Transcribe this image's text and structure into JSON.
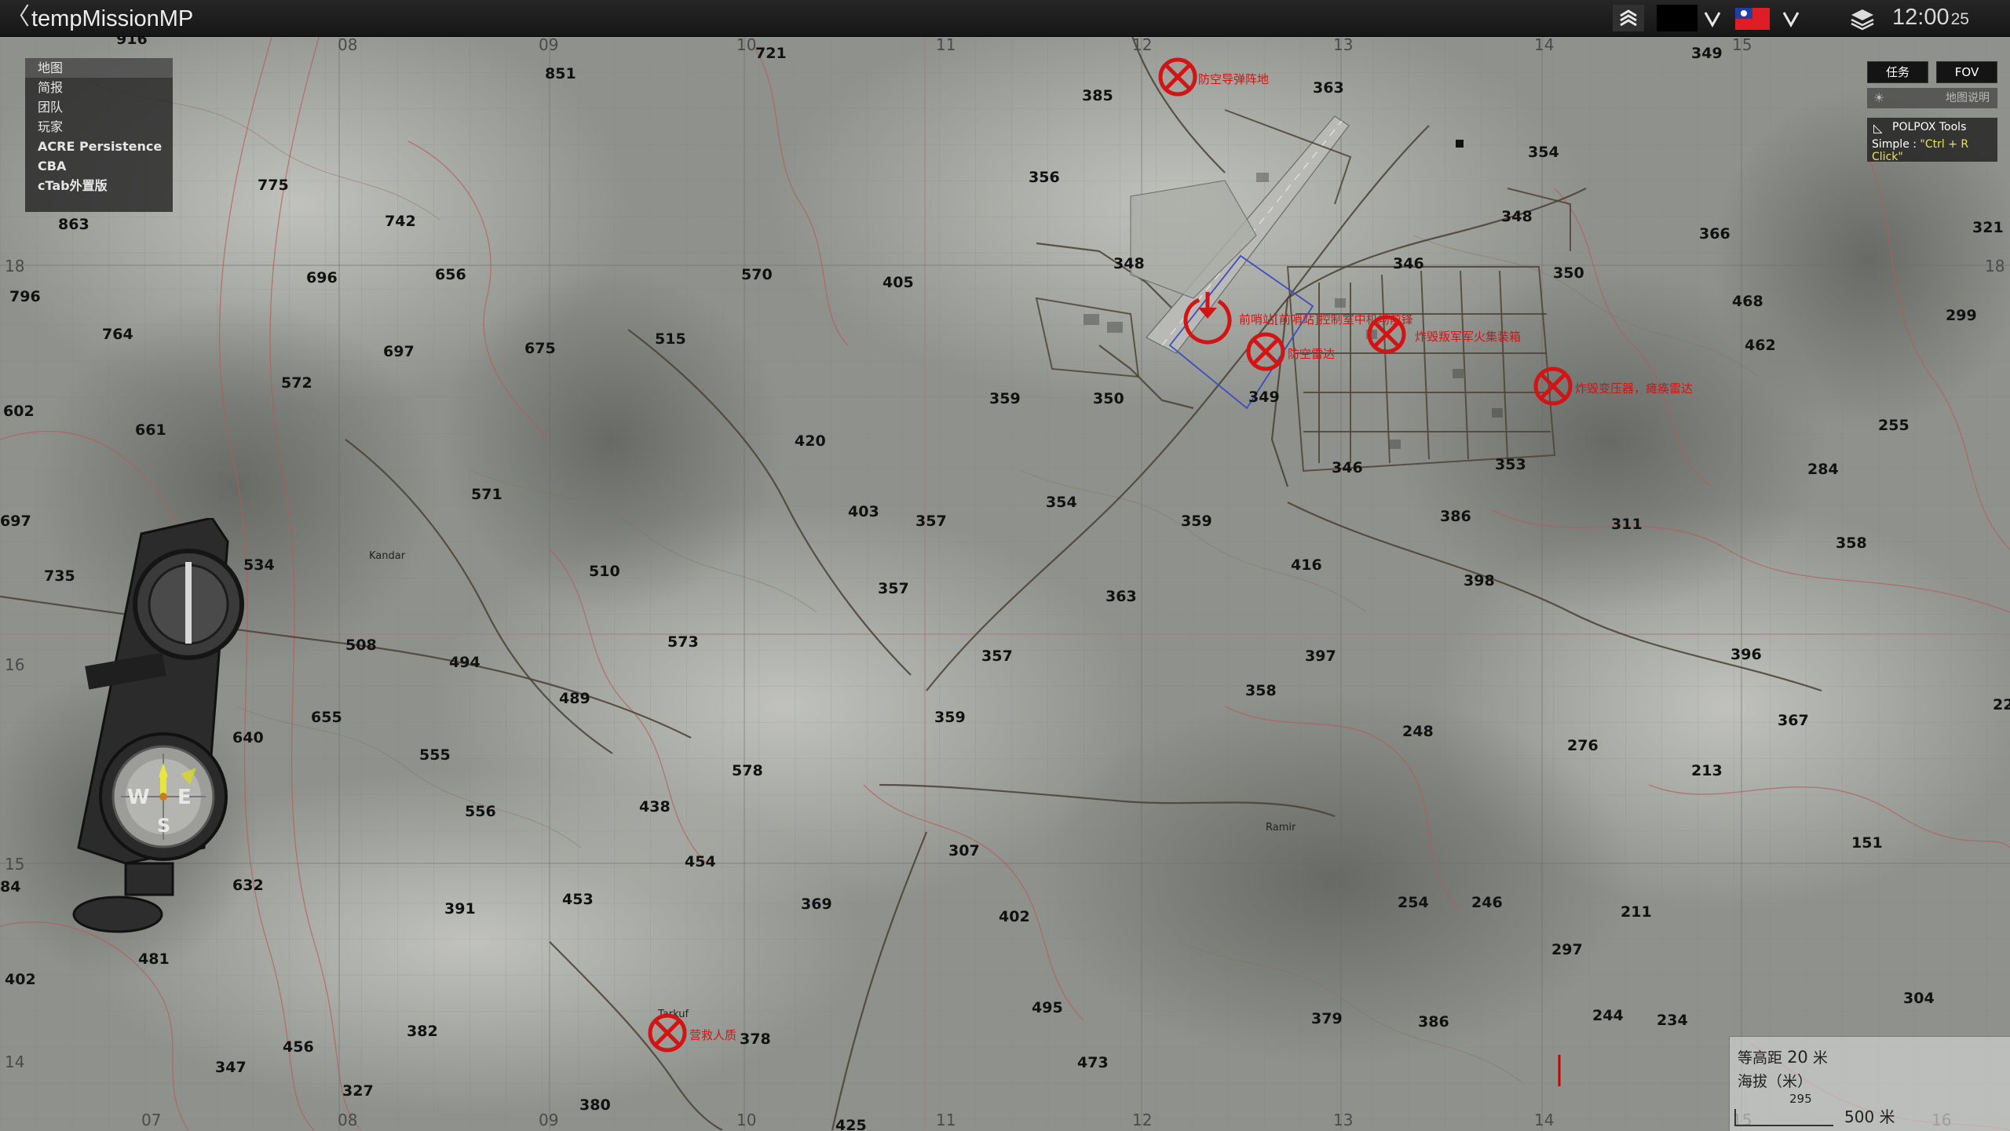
{
  "window": {
    "title": "tempMissionMP",
    "back_label": "〈"
  },
  "topbar": {
    "icons": [
      "map-layers-icon",
      "black-flag-icon",
      "chevron-down-icon",
      "taiwan-flag-icon",
      "chevron-down-icon",
      "layers-icon"
    ],
    "clock_hm": "12:00",
    "clock_s": "25"
  },
  "side_menu": {
    "items": [
      {
        "label": "地图",
        "active": true,
        "bold": false
      },
      {
        "label": "简报",
        "active": false,
        "bold": false
      },
      {
        "label": "团队",
        "active": false,
        "bold": false
      },
      {
        "label": "玩家",
        "active": false,
        "bold": false
      },
      {
        "label": "ACRE Persistence",
        "active": false,
        "bold": true
      },
      {
        "label": "CBA",
        "active": false,
        "bold": true
      },
      {
        "label": "cTab外置版",
        "active": false,
        "bold": true
      }
    ]
  },
  "right_panel": {
    "task_label": "任务",
    "fov_label": "FOV",
    "legend_label": "地图说明",
    "polpox_title": "POLPOX Tools",
    "polpox_hint_prefix": "Simple : ",
    "polpox_hint_key": "\"Ctrl + R Click\""
  },
  "scale": {
    "contour_label": "等高距",
    "contour_value": "20",
    "contour_unit": "米",
    "altitude_label": "海拔（米）",
    "altitude_value": "295",
    "distance_value": "500",
    "distance_unit": "米"
  },
  "grid": {
    "top_labels": [
      "08",
      "09",
      "10",
      "11",
      "12",
      "13",
      "14",
      "15"
    ],
    "bottom_labels": [
      "07",
      "08",
      "09",
      "10",
      "11",
      "12",
      "13",
      "14",
      "15",
      "16"
    ],
    "left_labels": [
      "18",
      "16",
      "15",
      "14"
    ]
  },
  "compass": {
    "w": "W",
    "e": "E",
    "s": "S"
  },
  "towns": [
    "Kandar",
    "Ramir",
    "Tarkuf"
  ],
  "markers": [
    {
      "type": "destroy",
      "label": "防空导弹阵地"
    },
    {
      "type": "start",
      "label": "前哨站[前哨站]控制室中机场前锋"
    },
    {
      "type": "destroy",
      "label": "防空雷达"
    },
    {
      "type": "destroy",
      "label": "炸毁叛军军火集装箱"
    },
    {
      "type": "destroy",
      "label": "炸毁变压器，瘫痪雷达"
    },
    {
      "type": "destroy",
      "label": "营救人质"
    }
  ],
  "elevations": [
    {
      "v": "916"
    },
    {
      "v": "851"
    },
    {
      "v": "721"
    },
    {
      "v": "385"
    },
    {
      "v": "363"
    },
    {
      "v": "349"
    },
    {
      "v": "356"
    },
    {
      "v": "354"
    },
    {
      "v": "348"
    },
    {
      "v": "366"
    },
    {
      "v": "321"
    },
    {
      "v": "775"
    },
    {
      "v": "863"
    },
    {
      "v": "742"
    },
    {
      "v": "696"
    },
    {
      "v": "656"
    },
    {
      "v": "570"
    },
    {
      "v": "405"
    },
    {
      "v": "348"
    },
    {
      "v": "346"
    },
    {
      "v": "350"
    },
    {
      "v": "796"
    },
    {
      "v": "468"
    },
    {
      "v": "299"
    },
    {
      "v": "764"
    },
    {
      "v": "697"
    },
    {
      "v": "675"
    },
    {
      "v": "515"
    },
    {
      "v": "462"
    },
    {
      "v": "572"
    },
    {
      "v": "359"
    },
    {
      "v": "350"
    },
    {
      "v": "349"
    },
    {
      "v": "602"
    },
    {
      "v": "661"
    },
    {
      "v": "420"
    },
    {
      "v": "255"
    },
    {
      "v": "346"
    },
    {
      "v": "353"
    },
    {
      "v": "284"
    },
    {
      "v": "571"
    },
    {
      "v": "403"
    },
    {
      "v": "357"
    },
    {
      "v": "354"
    },
    {
      "v": "359"
    },
    {
      "v": "386"
    },
    {
      "v": "311"
    },
    {
      "v": "697"
    },
    {
      "v": "735"
    },
    {
      "v": "534"
    },
    {
      "v": "510"
    },
    {
      "v": "416"
    },
    {
      "v": "398"
    },
    {
      "v": "358"
    },
    {
      "v": "357"
    },
    {
      "v": "363"
    },
    {
      "v": "508"
    },
    {
      "v": "494"
    },
    {
      "v": "573"
    },
    {
      "v": "357"
    },
    {
      "v": "397"
    },
    {
      "v": "396"
    },
    {
      "v": "489"
    },
    {
      "v": "358"
    },
    {
      "v": "655"
    },
    {
      "v": "359"
    },
    {
      "v": "248"
    },
    {
      "v": "367"
    },
    {
      "v": "22"
    },
    {
      "v": "640"
    },
    {
      "v": "555"
    },
    {
      "v": "578"
    },
    {
      "v": "276"
    },
    {
      "v": "213"
    },
    {
      "v": "556"
    },
    {
      "v": "438"
    },
    {
      "v": "307"
    },
    {
      "v": "151"
    },
    {
      "v": "454"
    },
    {
      "v": "84"
    },
    {
      "v": "632"
    },
    {
      "v": "453"
    },
    {
      "v": "391"
    },
    {
      "v": "369"
    },
    {
      "v": "402"
    },
    {
      "v": "254"
    },
    {
      "v": "246"
    },
    {
      "v": "211"
    },
    {
      "v": "481"
    },
    {
      "v": "297"
    },
    {
      "v": "402"
    },
    {
      "v": "495"
    },
    {
      "v": "304"
    },
    {
      "v": "379"
    },
    {
      "v": "386"
    },
    {
      "v": "244"
    },
    {
      "v": "234"
    },
    {
      "v": "456"
    },
    {
      "v": "382"
    },
    {
      "v": "378"
    },
    {
      "v": "347"
    },
    {
      "v": "473"
    },
    {
      "v": "327"
    },
    {
      "v": "380"
    },
    {
      "v": "425"
    }
  ]
}
